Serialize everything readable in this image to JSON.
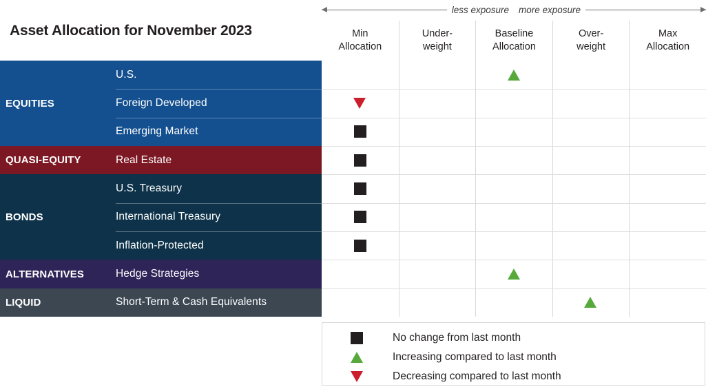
{
  "title": "Asset Allocation for November 2023",
  "exposure": {
    "less_label": "less exposure",
    "more_label": "more exposure",
    "left_arrow_icon": "arrow-left-icon",
    "right_arrow_icon": "arrow-right-icon"
  },
  "columns": [
    {
      "line1": "Min",
      "line2": "Allocation"
    },
    {
      "line1": "Under-",
      "line2": "weight"
    },
    {
      "line1": "Baseline",
      "line2": "Allocation"
    },
    {
      "line1": "Over-",
      "line2": "weight"
    },
    {
      "line1": "Max",
      "line2": "Allocation"
    }
  ],
  "groups": [
    {
      "name": "EQUITIES",
      "color": "#14508f",
      "rows": [
        {
          "label": "U.S.",
          "column": 2,
          "marker": "up"
        },
        {
          "label": "Foreign Developed",
          "column": 0,
          "marker": "down"
        },
        {
          "label": "Emerging Market",
          "column": 0,
          "marker": "square"
        }
      ]
    },
    {
      "name": "QUASI-EQUITY",
      "color": "#7c1823",
      "rows": [
        {
          "label": "Real Estate",
          "column": 0,
          "marker": "square"
        }
      ]
    },
    {
      "name": "BONDS",
      "color": "#0d3249",
      "rows": [
        {
          "label": "U.S. Treasury",
          "column": 0,
          "marker": "square"
        },
        {
          "label": "International Treasury",
          "column": 0,
          "marker": "square"
        },
        {
          "label": "Inflation-Protected",
          "column": 0,
          "marker": "square"
        }
      ]
    },
    {
      "name": "ALTERNATIVES",
      "color": "#2e2458",
      "rows": [
        {
          "label": "Hedge Strategies",
          "column": 2,
          "marker": "up"
        }
      ]
    },
    {
      "name": "LIQUID",
      "color": "#3c4752",
      "rows": [
        {
          "label": "Short-Term & Cash Equivalents",
          "column": 3,
          "marker": "up"
        }
      ]
    }
  ],
  "legend": [
    {
      "marker": "square",
      "text": "No change from last month"
    },
    {
      "marker": "up",
      "text": "Increasing compared to last month"
    },
    {
      "marker": "down",
      "text": "Decreasing compared to last month"
    }
  ],
  "colors": {
    "marker_neutral": "#231f20",
    "marker_increase": "#57a93c",
    "marker_decrease": "#cc1f2e",
    "gridline": "#d8d8d8"
  },
  "chart_data": {
    "type": "table",
    "title": "Asset Allocation for November 2023",
    "categories": [
      "Min Allocation",
      "Under-weight",
      "Baseline Allocation",
      "Over-weight",
      "Max Allocation"
    ],
    "xlabel": "",
    "ylabel": "",
    "annotations": [
      "less exposure",
      "more exposure"
    ],
    "legend_position": "bottom",
    "grid": true,
    "series": [
      {
        "name": "U.S.",
        "group": "EQUITIES",
        "position": "Baseline Allocation",
        "change": "Increasing compared to last month"
      },
      {
        "name": "Foreign Developed",
        "group": "EQUITIES",
        "position": "Min Allocation",
        "change": "Decreasing compared to last month"
      },
      {
        "name": "Emerging Market",
        "group": "EQUITIES",
        "position": "Min Allocation",
        "change": "No change from last month"
      },
      {
        "name": "Real Estate",
        "group": "QUASI-EQUITY",
        "position": "Min Allocation",
        "change": "No change from last month"
      },
      {
        "name": "U.S. Treasury",
        "group": "BONDS",
        "position": "Min Allocation",
        "change": "No change from last month"
      },
      {
        "name": "International Treasury",
        "group": "BONDS",
        "position": "Min Allocation",
        "change": "No change from last month"
      },
      {
        "name": "Inflation-Protected",
        "group": "BONDS",
        "position": "Min Allocation",
        "change": "No change from last month"
      },
      {
        "name": "Hedge Strategies",
        "group": "ALTERNATIVES",
        "position": "Baseline Allocation",
        "change": "Increasing compared to last month"
      },
      {
        "name": "Short-Term & Cash Equivalents",
        "group": "LIQUID",
        "position": "Over-weight",
        "change": "Increasing compared to last month"
      }
    ]
  }
}
